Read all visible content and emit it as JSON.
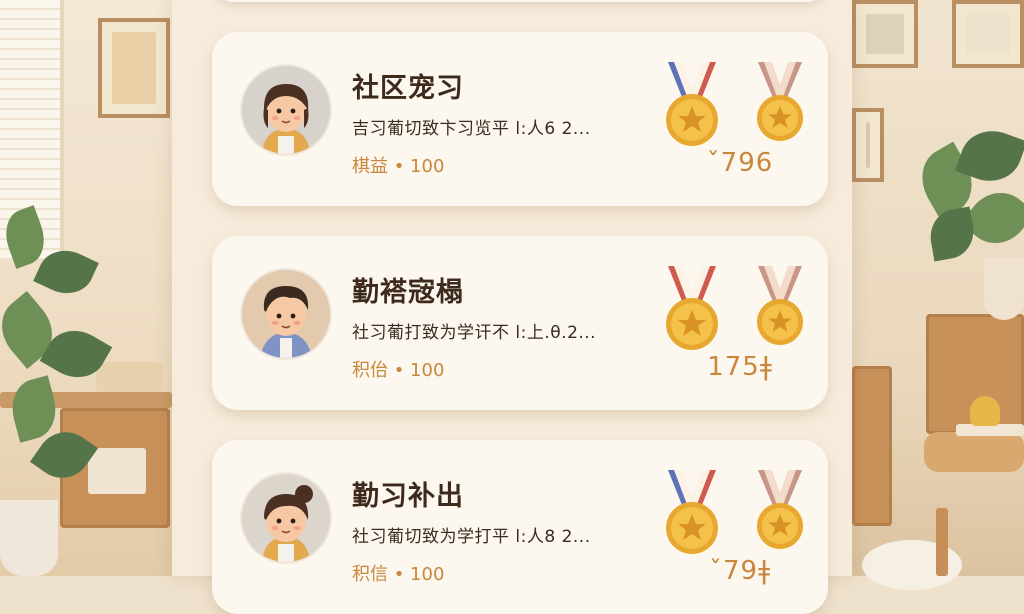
{
  "cards": [
    {
      "title": "社区宠习",
      "description": "吉习葡切致卞习览平 l:人6 2...",
      "points": "棋益 • 100",
      "score": "ˇ796",
      "avatar": "girl-avatar",
      "medals": [
        {
          "ribbon": "blue-red",
          "icon": "star-medal-icon"
        },
        {
          "ribbon": "pink",
          "icon": "star-medal-icon"
        }
      ]
    },
    {
      "title": "勤褡宼榻",
      "description": "社习葡打致为学讦不 l:上.θ.2...",
      "points": "积佁 • 100",
      "score": "175ǂ",
      "avatar": "boy-avatar",
      "medals": [
        {
          "ribbon": "red",
          "icon": "star-medal-icon"
        },
        {
          "ribbon": "pink",
          "icon": "star-medal-icon"
        }
      ]
    },
    {
      "title": "勤习补出",
      "description": "社习葡切致为学打平 l:人8 2...",
      "points": "积信 • 100",
      "score": "ˇ79ǂ",
      "avatar": "bun-girl-avatar",
      "medals": [
        {
          "ribbon": "blue-red",
          "icon": "star-medal-icon"
        },
        {
          "ribbon": "pink",
          "icon": "star-medal-icon"
        }
      ]
    }
  ],
  "colors": {
    "accent": "#c8873d",
    "title": "#3e2a1c",
    "card_bg": "#fdf8ef",
    "gold": "#f0b93c"
  }
}
